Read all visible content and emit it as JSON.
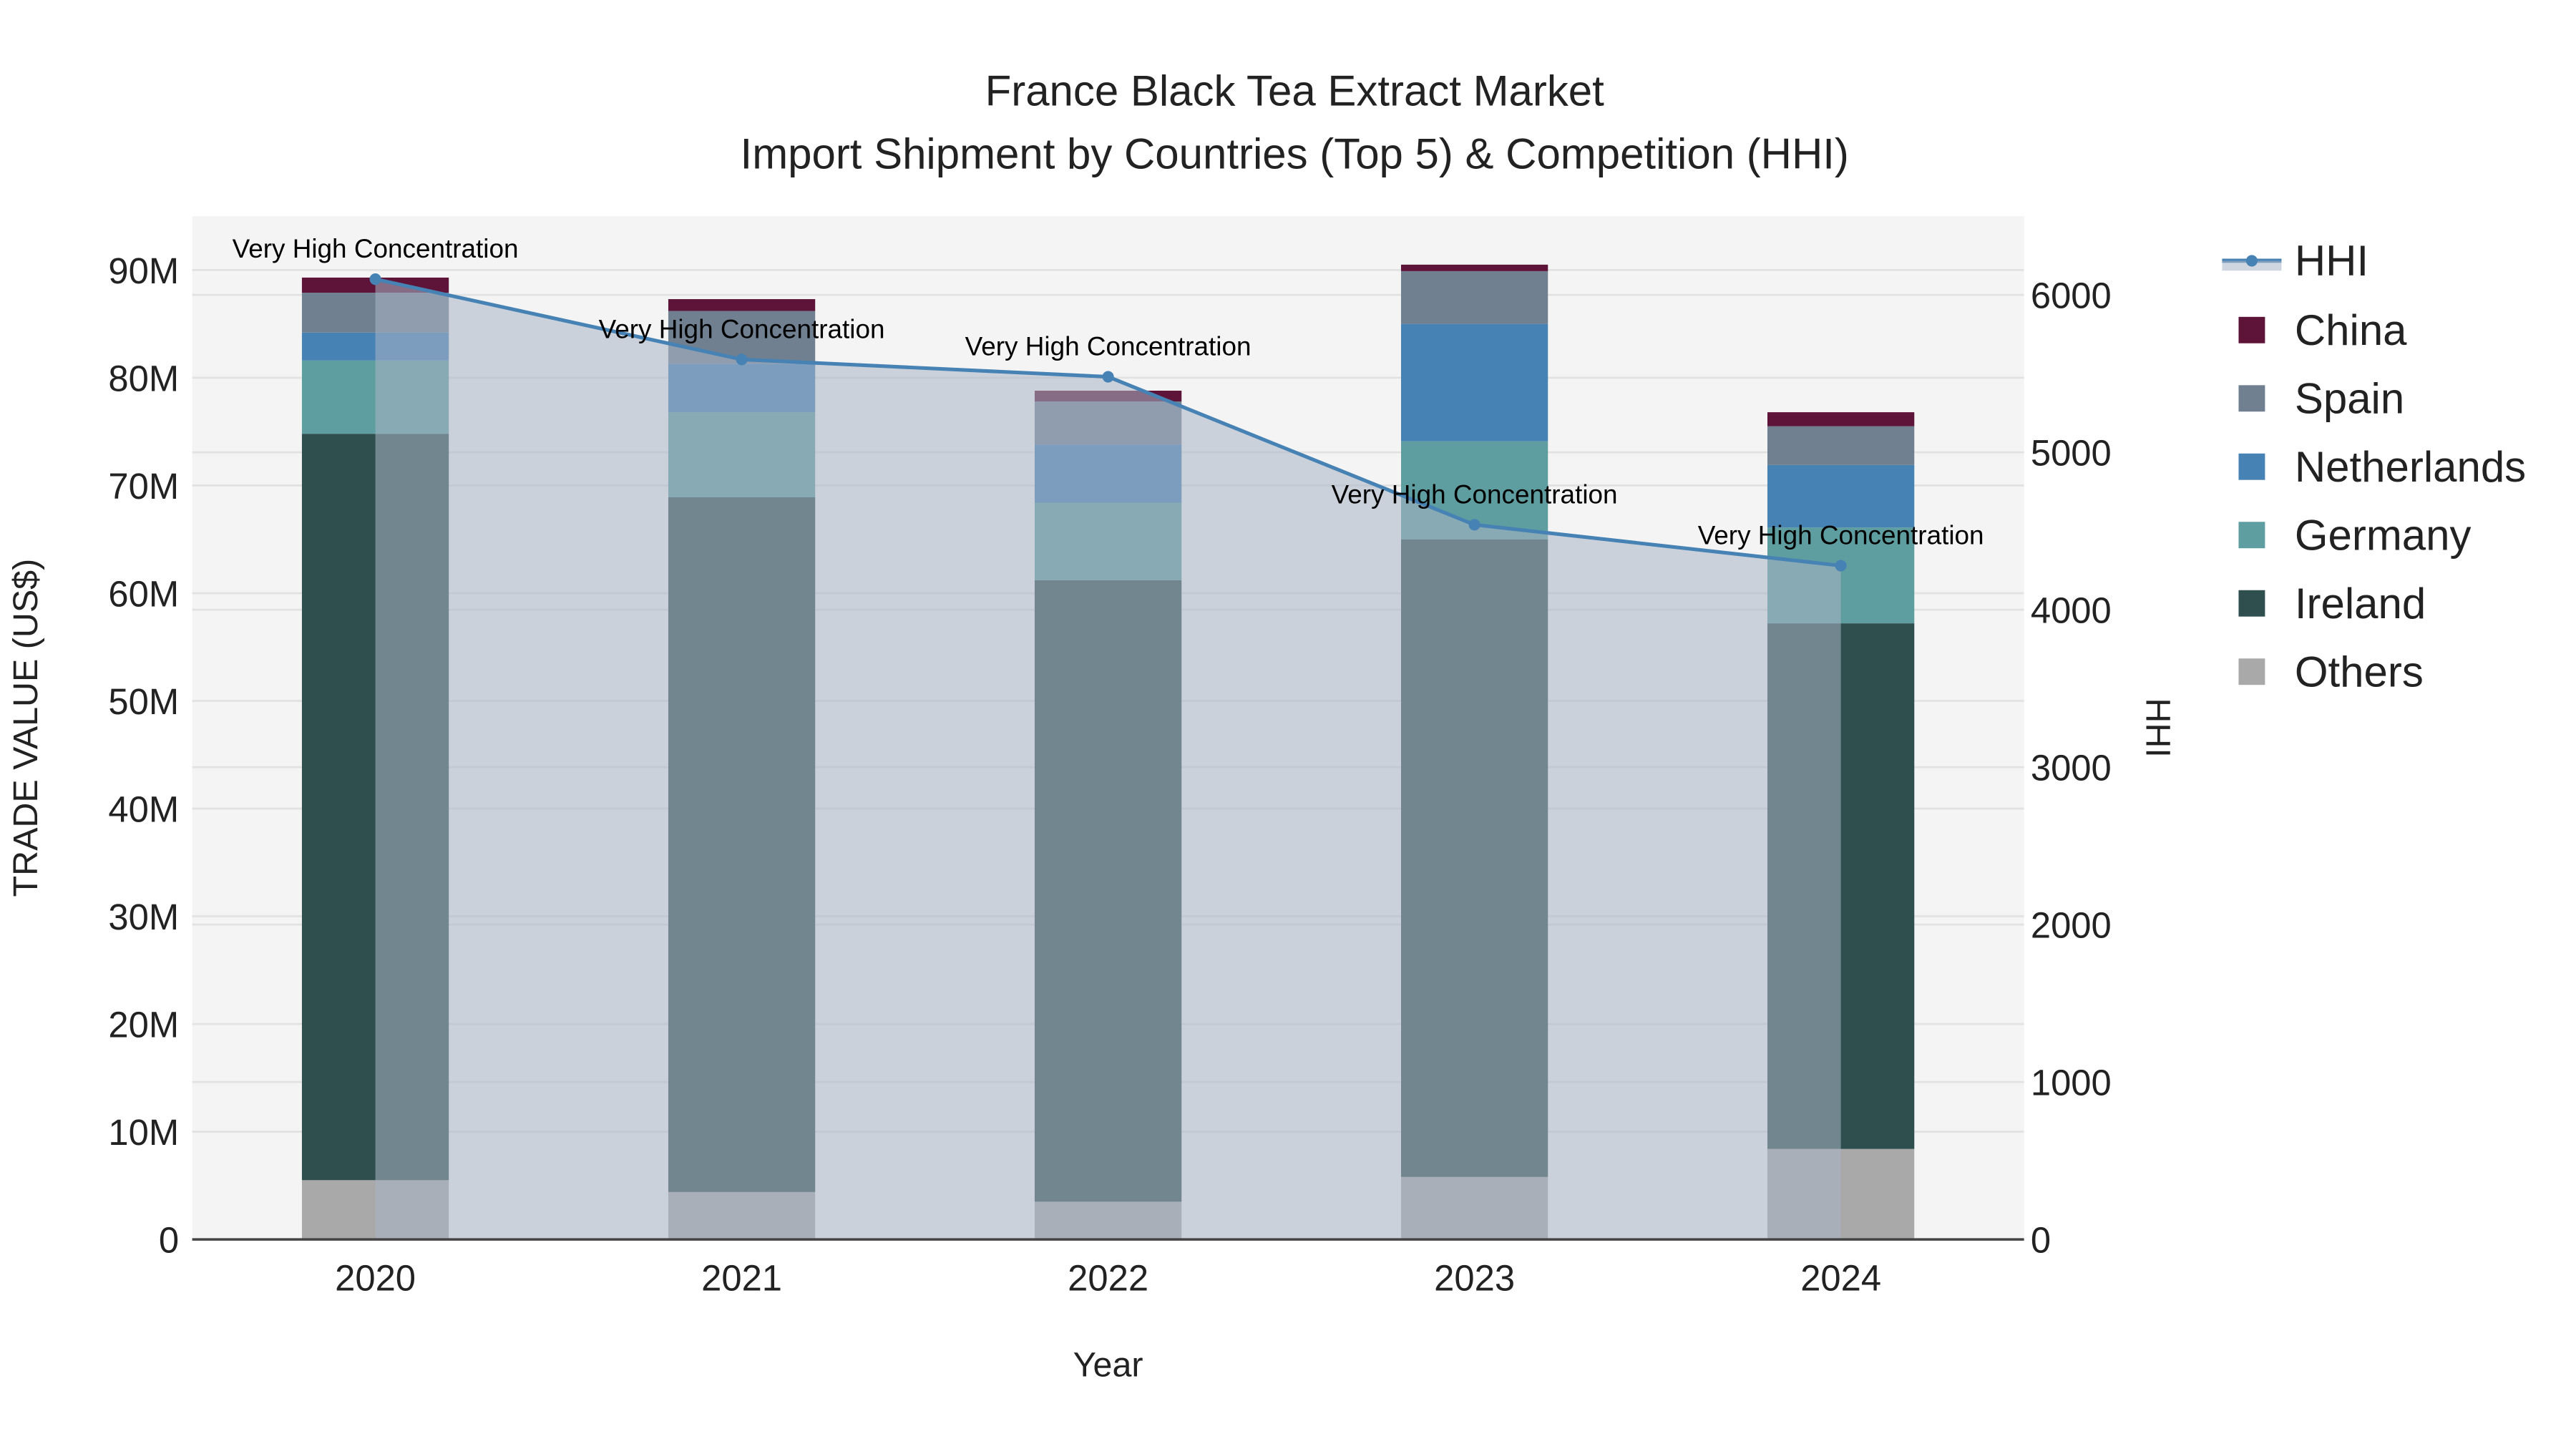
{
  "chart_data": {
    "type": "bar",
    "title": "France Black Tea Extract Market",
    "subtitle": "Import Shipment by Countries (Top 5) & Competition (HHI)",
    "xlabel": "Year",
    "ylabel": "TRADE VALUE (US$)",
    "y2label": "HHI",
    "categories": [
      "2020",
      "2021",
      "2022",
      "2023",
      "2024"
    ],
    "ylim": [
      0,
      95
    ],
    "y_ticks": [
      0,
      10,
      20,
      30,
      40,
      50,
      60,
      70,
      80,
      90
    ],
    "y_tick_labels": [
      "0",
      "10M",
      "20M",
      "30M",
      "40M",
      "50M",
      "60M",
      "70M",
      "80M",
      "90M"
    ],
    "y2lim": [
      0,
      6500
    ],
    "y2_ticks": [
      0,
      1000,
      2000,
      3000,
      4000,
      5000,
      6000
    ],
    "y2_tick_labels": [
      "0",
      "1000",
      "2000",
      "3000",
      "4000",
      "5000",
      "6000"
    ],
    "stacked": true,
    "units": "million US$",
    "series": [
      {
        "name": "Others",
        "color": "#a9a9a9",
        "values": [
          5.5,
          4.4,
          3.5,
          5.8,
          8.4
        ]
      },
      {
        "name": "Ireland",
        "color": "#2f4f4f",
        "values": [
          69.3,
          64.5,
          57.7,
          59.2,
          48.8
        ]
      },
      {
        "name": "Germany",
        "color": "#5f9ea0",
        "values": [
          6.8,
          7.9,
          7.2,
          9.1,
          8.9
        ]
      },
      {
        "name": "Netherlands",
        "color": "#4682b4",
        "values": [
          2.6,
          4.5,
          5.4,
          10.9,
          5.8
        ]
      },
      {
        "name": "Spain",
        "color": "#708090",
        "values": [
          3.7,
          4.9,
          4.0,
          4.9,
          3.6
        ]
      },
      {
        "name": "China",
        "color": "#5e1438",
        "values": [
          1.4,
          1.1,
          1.0,
          0.6,
          1.3
        ]
      }
    ],
    "line": {
      "name": "HHI",
      "color": "#4682b4",
      "axis": "right",
      "values": [
        6100,
        5590,
        5480,
        4540,
        4280
      ]
    },
    "annotations": [
      "Very High Concentration",
      "Very High Concentration",
      "Very High Concentration",
      "Very High Concentration",
      "Very High Concentration"
    ],
    "legend": [
      "HHI",
      "China",
      "Spain",
      "Netherlands",
      "Germany",
      "Ireland",
      "Others"
    ],
    "legend_position": "right",
    "grid": true
  }
}
